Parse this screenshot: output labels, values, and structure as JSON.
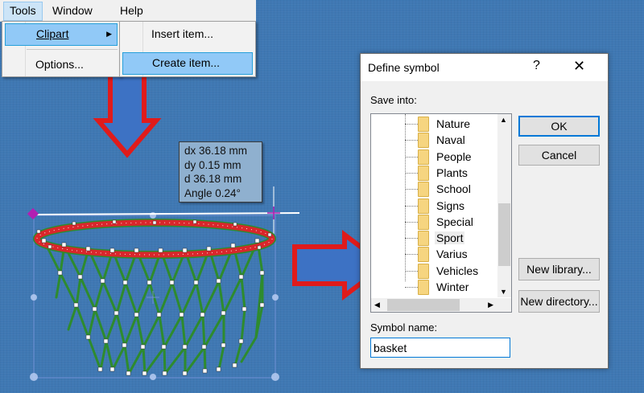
{
  "menubar": {
    "tools": "Tools",
    "window": "Window",
    "help": "Help"
  },
  "tools_menu": {
    "clipart": "Clipart",
    "options": "Options..."
  },
  "clipart_menu": {
    "insert_item": "Insert item...",
    "create_item": "Create item..."
  },
  "tooltip": {
    "dx": "dx 36.18 mm",
    "dy": "dy 0.15 mm",
    "d": "d 36.18 mm",
    "angle": "Angle 0.24°"
  },
  "dialog": {
    "title": "Define symbol",
    "help_glyph": "?",
    "close_glyph": "✕",
    "save_into_label": "Save into:",
    "folders": [
      "Nature",
      "Naval",
      "People",
      "Plants",
      "School",
      "Signs",
      "Special",
      "Sport",
      "Varius",
      "Vehicles",
      "Winter"
    ],
    "selected_folder": "Sport",
    "ok_label": "OK",
    "cancel_label": "Cancel",
    "new_library_label": "New library...",
    "new_directory_label": "New directory...",
    "symbol_name_label": "Symbol name:",
    "symbol_name_value": "basket"
  },
  "colors": {
    "background": "#3f78b3",
    "arrow_fill": "#3d72c4",
    "arrow_border": "#e01b1b",
    "rim": "#d9262b",
    "net": "#2e8b2e",
    "handle": "#b21fb2"
  }
}
